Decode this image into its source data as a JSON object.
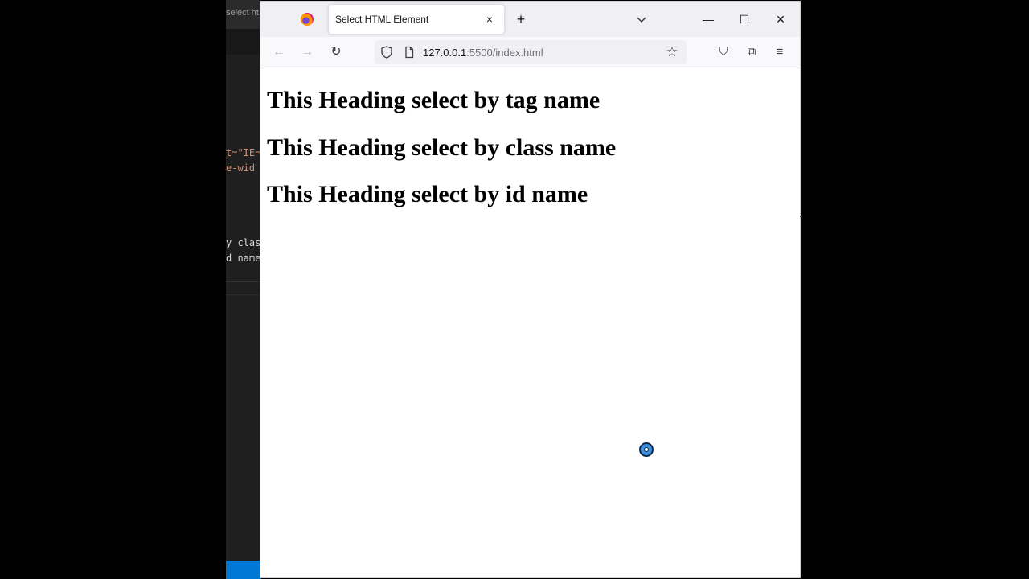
{
  "editor": {
    "title_fragment": "select ht",
    "code_lines": [
      {
        "text": "t=\"IE=",
        "color": "#ce9178"
      },
      {
        "text": "e-wid",
        "color": "#ce9178"
      },
      {
        "text": "y clas",
        "color": "#d4d4d4"
      },
      {
        "text": "d name",
        "color": "#d4d4d4"
      }
    ]
  },
  "browser": {
    "tab": {
      "title": "Select HTML Element",
      "close_icon": "×"
    },
    "new_tab_icon": "+",
    "window_controls": {
      "minimize": "—",
      "maximize": "☐",
      "close": "✕"
    },
    "nav": {
      "back": "←",
      "forward": "→",
      "reload": "↻"
    },
    "url": {
      "host": "127.0.0.1",
      "rest": ":5500/index.html"
    },
    "toolbar": {
      "bookmark": "☆",
      "pocket": "⛉",
      "extensions": "⧉",
      "menu": "≡"
    }
  },
  "page": {
    "headings": [
      "This Heading select by tag name",
      "This Heading select by class name",
      "This Heading select by id name"
    ]
  }
}
